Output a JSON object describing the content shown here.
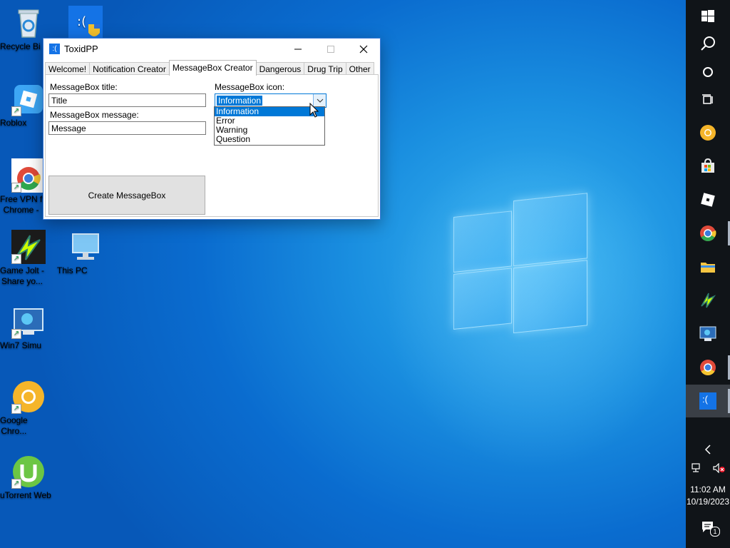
{
  "desktop": {
    "icons": [
      {
        "id": "recycle-bin",
        "label": "Recycle Bi"
      },
      {
        "id": "toxidpp",
        "label": ""
      },
      {
        "id": "roblox",
        "label": "Roblox"
      },
      {
        "id": "free-vpn-chrome",
        "label": "Free VPN f\nChrome -"
      },
      {
        "id": "game-jolt",
        "label": "Game Jolt -\nShare yo..."
      },
      {
        "id": "this-pc",
        "label": "This PC"
      },
      {
        "id": "win7-simu",
        "label": "Win7 Simu"
      },
      {
        "id": "google-chrome",
        "label": "Google\nChro..."
      },
      {
        "id": "utorrent-web",
        "label": "uTorrent Web"
      }
    ]
  },
  "window": {
    "title": "ToxidPP",
    "app_icon_text": ":(",
    "tabs": [
      "Welcome!",
      "Notification Creator",
      "MessageBox Creator",
      "Dangerous",
      "Drug Trip",
      "Other"
    ],
    "active_tab": "MessageBox Creator",
    "form": {
      "title_label": "MessageBox title:",
      "title_value": "Title",
      "message_label": "MessageBox message:",
      "message_value": "Message",
      "icon_label": "MessageBox icon:",
      "icon_selected": "Information",
      "icon_options": [
        "Information",
        "Error",
        "Warning",
        "Question"
      ],
      "create_button": "Create MessageBox"
    }
  },
  "taskbar": {
    "time": "11:02 AM",
    "date": "10/19/2023",
    "notification_count": "1",
    "active_app_glyph": ":("
  },
  "colors": {
    "accent": "#0078d7",
    "taskbar": "#101418",
    "window_border": "#3b7ad6"
  }
}
